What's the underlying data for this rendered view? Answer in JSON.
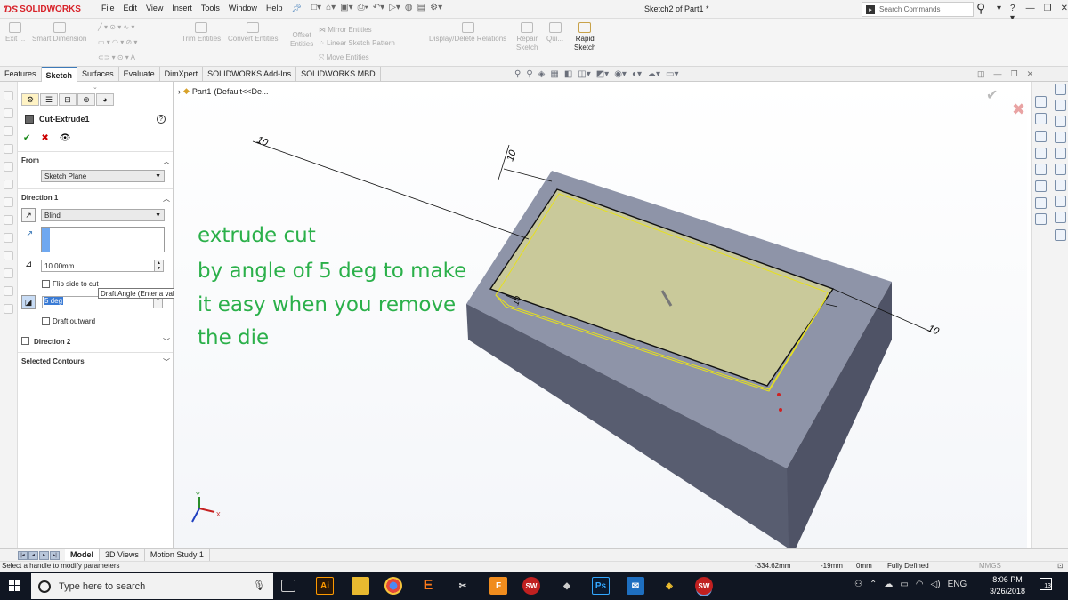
{
  "app": {
    "brand": "SOLIDWORKS",
    "document_title": "Sketch2 of Part1 *"
  },
  "menu": [
    "File",
    "Edit",
    "View",
    "Insert",
    "Tools",
    "Window",
    "Help"
  ],
  "search": {
    "placeholder": "Search Commands"
  },
  "commands": {
    "exit": "Exit ...",
    "smart_dimension": "Smart Dimension",
    "trim_entities": "Trim Entities",
    "convert_entities": "Convert Entities",
    "offset_entities_1": "Offset",
    "offset_entities_2": "Entities",
    "mirror_entities": "Mirror Entities",
    "linear_sketch_pattern": "Linear Sketch Pattern",
    "move_entities": "Move Entities",
    "display_delete_relations": "Display/Delete Relations",
    "repair_sketch_1": "Repair",
    "repair_sketch_2": "Sketch",
    "quick_snaps": "Qui...",
    "rapid_sketch_1": "Rapid",
    "rapid_sketch_2": "Sketch"
  },
  "tabs": [
    "Features",
    "Sketch",
    "Surfaces",
    "Evaluate",
    "DimXpert",
    "SOLIDWORKS Add-Ins",
    "SOLIDWORKS MBD"
  ],
  "active_tab": "Sketch",
  "tree": {
    "part": "Part1",
    "config": "(Default<<De..."
  },
  "property_manager": {
    "title": "Cut-Extrude1",
    "from_label": "From",
    "from_value": "Sketch Plane",
    "direction1_label": "Direction 1",
    "end_condition": "Blind",
    "depth": "10.00mm",
    "flip_side_label": "Flip side to cut",
    "draft_angle": "5 deg",
    "draft_outward_label": "Draft outward",
    "direction2_label": "Direction 2",
    "selected_contours_label": "Selected Contours",
    "tooltip": "Draft Angle (Enter a value or start with = to create an equation)"
  },
  "viewport": {
    "dimensions": [
      "10",
      "10",
      "10",
      "10"
    ],
    "annotation_lines": [
      "extrude cut",
      "by angle of 5 deg to make",
      "it easy when you remove",
      "the die"
    ],
    "triad": {
      "x": "X",
      "y": "Y"
    }
  },
  "bottom_tabs": [
    "Model",
    "3D Views",
    "Motion Study 1"
  ],
  "active_bottom_tab": "Model",
  "status": {
    "message": "Select a handle to modify parameters",
    "x": "-334.62mm",
    "y": "-19mm",
    "z": "0mm",
    "state": "Fully Defined",
    "units": "MMGS"
  },
  "taskbar": {
    "search_placeholder": "Type here to search",
    "language": "ENG",
    "time": "8:06 PM",
    "date": "3/26/2018",
    "notification_count": "13",
    "app_labels": [
      "Ai",
      "Ps"
    ]
  },
  "colors": {
    "annotation": "#2bb04a",
    "part_face_top": "#8e94a8",
    "part_face_side": "#5d6277",
    "sketch_face": "#c9c99a",
    "accent": "#3d7ab8"
  }
}
